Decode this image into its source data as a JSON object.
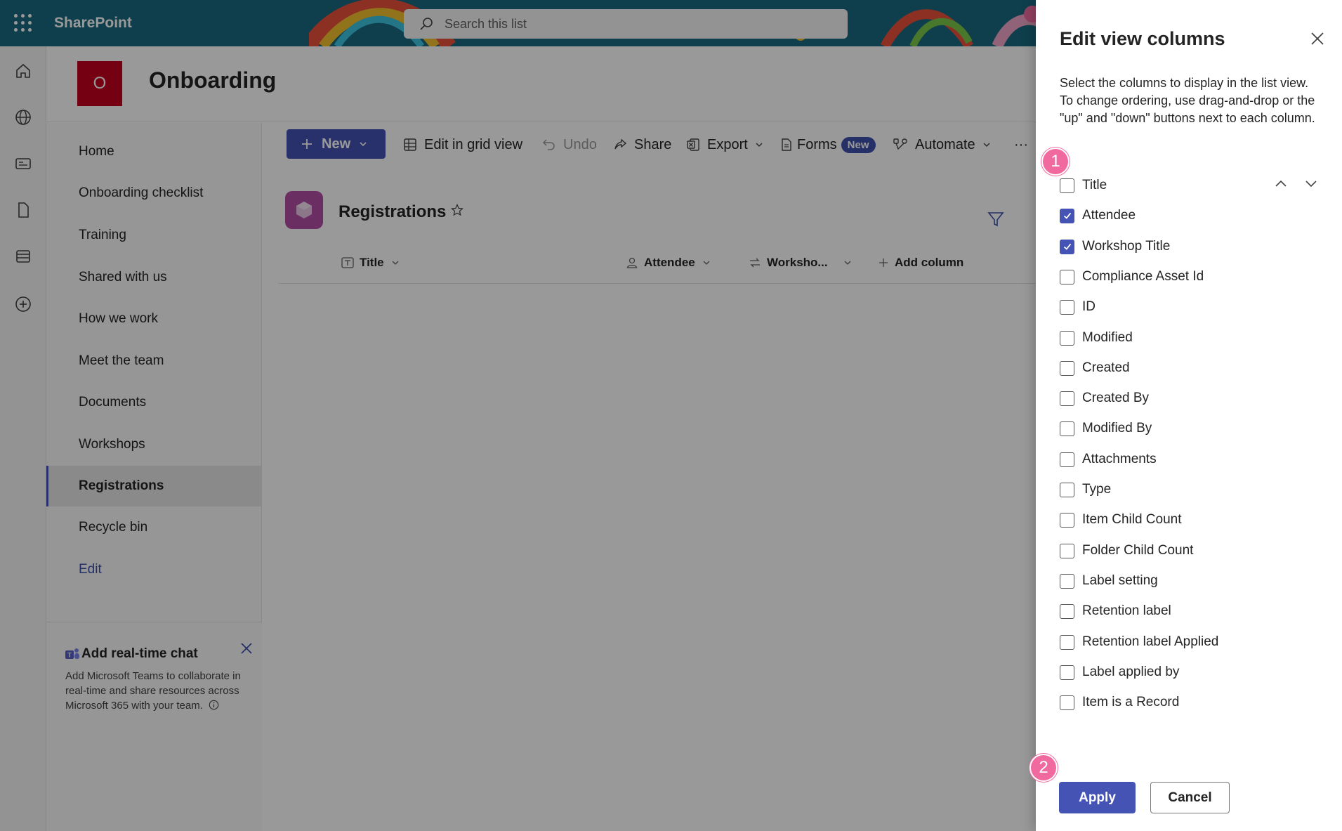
{
  "suitebar": {
    "brand": "SharePoint",
    "search_placeholder": "Search this list"
  },
  "site": {
    "logo_letter": "O",
    "title": "Onboarding"
  },
  "nav": {
    "items": [
      {
        "label": "Home"
      },
      {
        "label": "Onboarding checklist"
      },
      {
        "label": "Training"
      },
      {
        "label": "Shared with us"
      },
      {
        "label": "How we work"
      },
      {
        "label": "Meet the team"
      },
      {
        "label": "Documents"
      },
      {
        "label": "Workshops"
      },
      {
        "label": "Registrations"
      },
      {
        "label": "Recycle bin"
      },
      {
        "label": "Edit"
      }
    ],
    "active": "Registrations"
  },
  "chat_card": {
    "title": "Add real-time chat",
    "body": "Add Microsoft Teams to collaborate in real-time and share resources across Microsoft 365 with your team."
  },
  "command_bar": {
    "new_label": "New",
    "edit_grid_label": "Edit in grid view",
    "undo_label": "Undo",
    "share_label": "Share",
    "export_label": "Export",
    "forms_label": "Forms",
    "forms_badge": "New",
    "automate_label": "Automate",
    "more_label": "···"
  },
  "list": {
    "title": "Registrations",
    "columns": [
      "Title",
      "Attendee",
      "Worksho...",
      "Add column"
    ]
  },
  "panel": {
    "title": "Edit view columns",
    "description": "Select the columns to display in the list view. To change ordering, use drag-and-drop or the \"up\" and \"down\" buttons next to each column.",
    "columns": [
      {
        "label": "Title",
        "checked": false
      },
      {
        "label": "Attendee",
        "checked": true
      },
      {
        "label": "Workshop Title",
        "checked": true
      },
      {
        "label": "Compliance Asset Id",
        "checked": false
      },
      {
        "label": "ID",
        "checked": false
      },
      {
        "label": "Modified",
        "checked": false
      },
      {
        "label": "Created",
        "checked": false
      },
      {
        "label": "Created By",
        "checked": false
      },
      {
        "label": "Modified By",
        "checked": false
      },
      {
        "label": "Attachments",
        "checked": false
      },
      {
        "label": "Type",
        "checked": false
      },
      {
        "label": "Item Child Count",
        "checked": false
      },
      {
        "label": "Folder Child Count",
        "checked": false
      },
      {
        "label": "Label setting",
        "checked": false
      },
      {
        "label": "Retention label",
        "checked": false
      },
      {
        "label": "Retention label Applied",
        "checked": false
      },
      {
        "label": "Label applied by",
        "checked": false
      },
      {
        "label": "Item is a Record",
        "checked": false
      }
    ],
    "apply_label": "Apply",
    "cancel_label": "Cancel"
  },
  "callouts": [
    "1",
    "2"
  ],
  "colors": {
    "accent": "#4553b5",
    "suitebar": "#1a6a80",
    "site_logo": "#c4001f",
    "callout": "#f06aa0"
  }
}
